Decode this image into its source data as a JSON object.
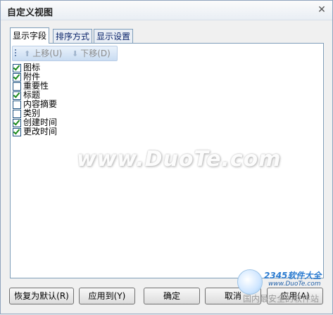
{
  "window": {
    "title": "自定义视图",
    "close_glyph": "✕"
  },
  "tabs": [
    {
      "label": "显示字段",
      "active": true
    },
    {
      "label": "排序方式",
      "active": false
    },
    {
      "label": "显示设置",
      "active": false
    }
  ],
  "toolbar": {
    "move_up_label": "上移(U)",
    "move_down_label": "下移(D)",
    "up_arrow": "⬆",
    "down_arrow": "⬇"
  },
  "fields": [
    {
      "label": "图标",
      "checked": true
    },
    {
      "label": "附件",
      "checked": true
    },
    {
      "label": "重要性",
      "checked": false
    },
    {
      "label": "标题",
      "checked": true
    },
    {
      "label": "内容摘要",
      "checked": false
    },
    {
      "label": "类别",
      "checked": false
    },
    {
      "label": "创建时间",
      "checked": true
    },
    {
      "label": "更改时间",
      "checked": true
    }
  ],
  "buttons": {
    "reset": "恢复为默认(R)",
    "apply_to": "应用到(Y)",
    "ok": "确定",
    "cancel": "取消",
    "apply": "应用(A)"
  },
  "watermark": "www.DuoTe.com",
  "badge": {
    "brand": "2345软件大全",
    "url": "www.DuoTe.com",
    "slogan": "国内最安全的软件站"
  }
}
